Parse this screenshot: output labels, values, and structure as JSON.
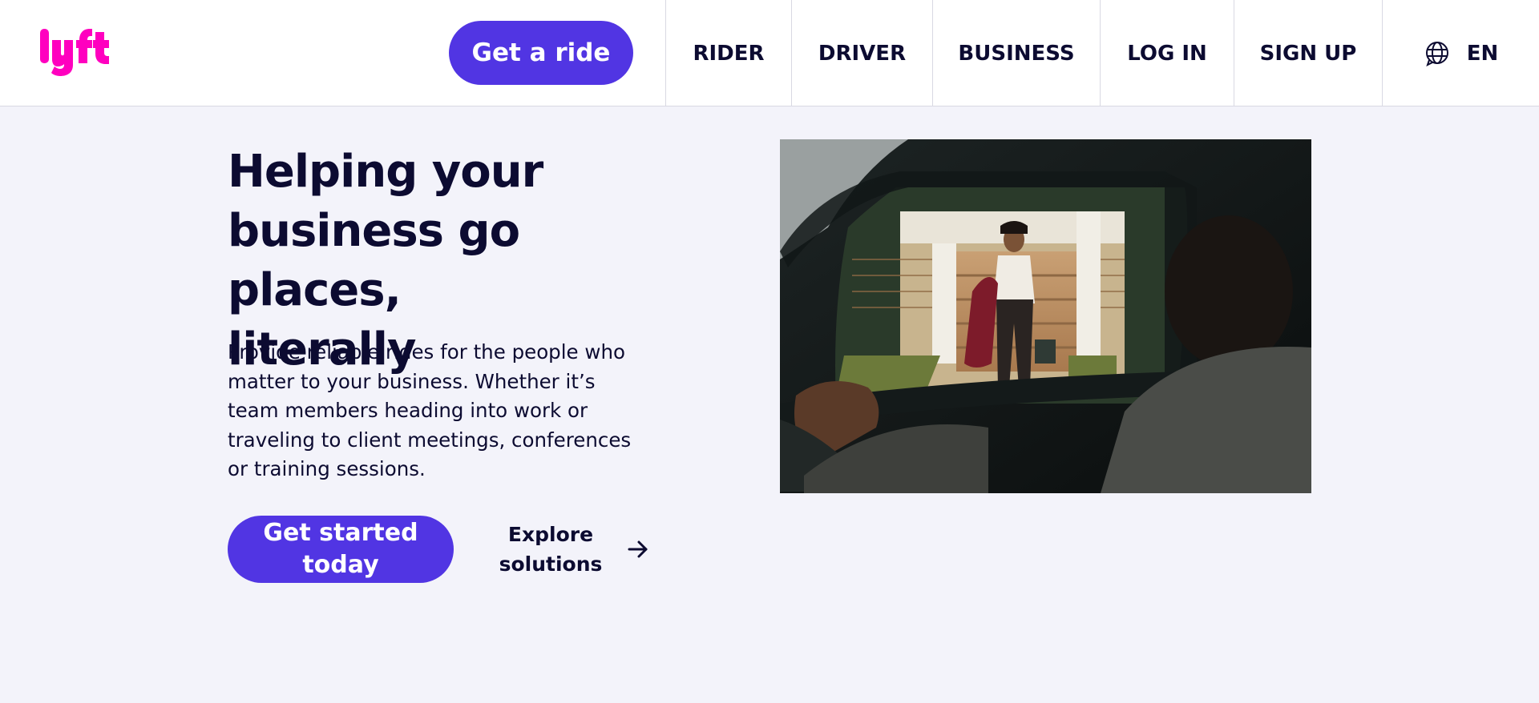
{
  "brand": {
    "logo_text": "lyft",
    "logo_color": "#ff00bf",
    "accent": "#5135e3",
    "text_color": "#0c0b31"
  },
  "header": {
    "get_ride_label": "Get a ride",
    "nav": [
      {
        "label": "RIDER"
      },
      {
        "label": "DRIVER"
      },
      {
        "label": "BUSINESS"
      },
      {
        "label": "LOG IN"
      },
      {
        "label": "SIGN UP"
      }
    ],
    "language": {
      "icon": "globe-icon",
      "label": "EN"
    }
  },
  "hero": {
    "headline_lines": [
      "Helping your",
      "business go places,",
      "literally"
    ],
    "description": "Provide reliable rides for the people who matter to your business. Whether it’s team members heading into work or traveling to client meetings, conferences or training sessions.",
    "cta_primary_lines": [
      "Get started",
      "today"
    ],
    "cta_secondary_lines": [
      "Explore",
      "solutions"
    ],
    "cta_secondary_icon": "arrow-right-icon",
    "image_icon": "hero-photo"
  }
}
